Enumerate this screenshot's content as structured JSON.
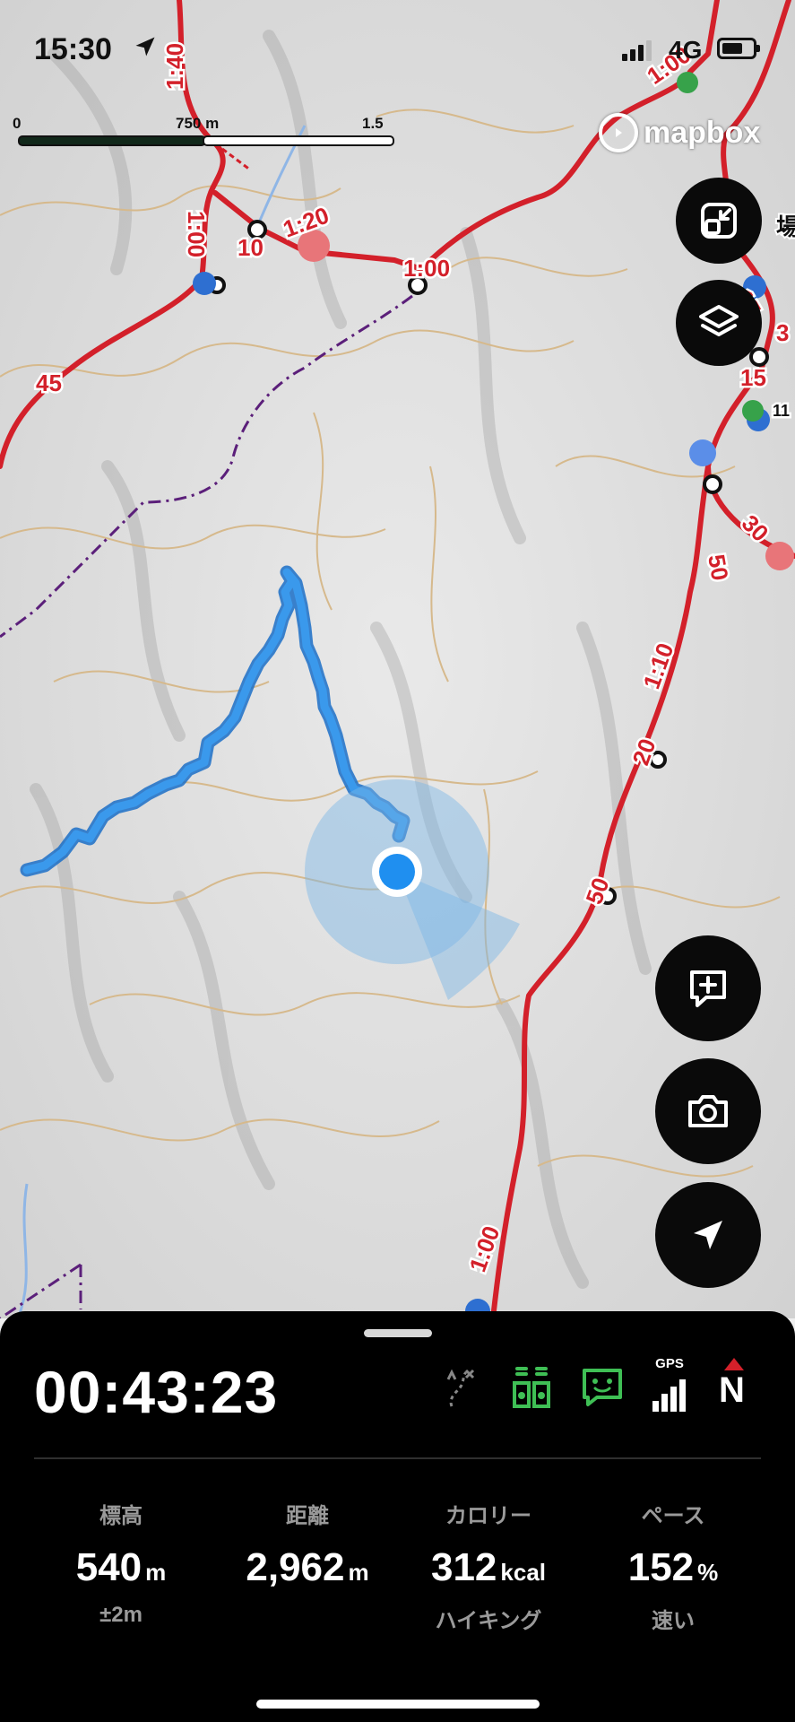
{
  "status_bar": {
    "time": "15:30",
    "network": "4G"
  },
  "scale": {
    "start": "0",
    "mid": "750 m",
    "end": "1.5 km"
  },
  "map": {
    "attribution": "mapbox",
    "time_labels": [
      "1:40",
      "1:00",
      "1:00",
      "1:20",
      "10",
      "45",
      "1:00",
      "1:00",
      "50",
      "1:10",
      "20",
      "50",
      "1:00",
      "15",
      "15",
      "30",
      "3",
      "11"
    ],
    "place_labels": [
      "場"
    ]
  },
  "controls": {
    "fullscreen_icon": "collapse-icon",
    "layers_icon": "layers-icon",
    "add_note_icon": "add-note-icon",
    "camera_icon": "camera-icon",
    "locate_icon": "navigation-arrow-icon"
  },
  "panel": {
    "elapsed": "00:43:23",
    "gps_label": "GPS",
    "compass_label": "N",
    "stats": [
      {
        "label": "標高",
        "value": "540",
        "unit": "m",
        "sub": "±2m"
      },
      {
        "label": "距離",
        "value": "2,962",
        "unit": "m",
        "sub": ""
      },
      {
        "label": "カロリー",
        "value": "312",
        "unit": "kcal",
        "sub": "ハイキング"
      },
      {
        "label": "ペース",
        "value": "152",
        "unit": "%",
        "sub": "速い"
      }
    ]
  },
  "colors": {
    "route_red": "#d3202a",
    "track_blue": "#2f8fe0",
    "contour": "#d6b98c"
  }
}
